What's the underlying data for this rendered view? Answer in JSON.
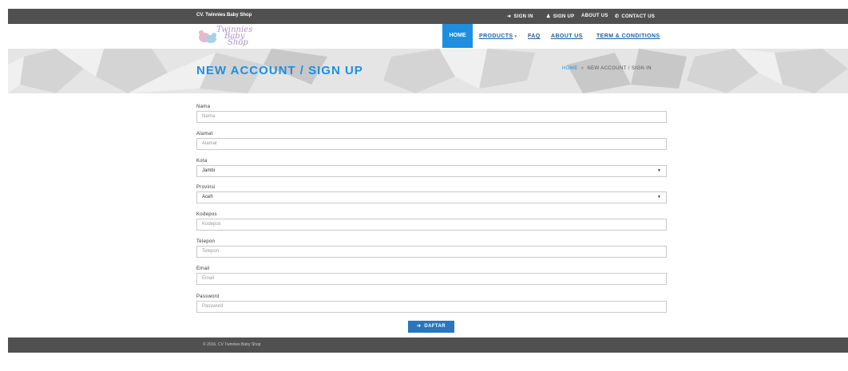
{
  "topbar": {
    "shop_name": "CV. Twinnies Baby Shop",
    "links": [
      {
        "label": "SIGN IN",
        "icon": "sign-in-icon"
      },
      {
        "label": "SIGN UP",
        "icon": "user-icon"
      },
      {
        "label": "ABOUT US",
        "icon": ""
      },
      {
        "label": "CONTACT US",
        "icon": "phone-icon"
      }
    ]
  },
  "logo": {
    "line1": "Twinnies",
    "line2": "Baby",
    "line3": "Shop"
  },
  "nav": {
    "home": "HOME",
    "products": "PRODUCTS",
    "faq": "FAQ",
    "about": "ABOUT US",
    "terms": "TERM & CONDITIONS"
  },
  "banner": {
    "title": "NEW ACCOUNT / SIGN UP",
    "breadcrumb_home": "HOME",
    "breadcrumb_separator": "»",
    "breadcrumb_current": "NEW ACCOUNT / SIGN IN"
  },
  "form": {
    "fields": [
      {
        "label": "Nama",
        "type": "text",
        "placeholder": "Nama"
      },
      {
        "label": "Alamat",
        "type": "text",
        "placeholder": "Alamat"
      },
      {
        "label": "Kota",
        "type": "select",
        "value": "Jambi"
      },
      {
        "label": "Provinsi",
        "type": "select",
        "value": "Aceh"
      },
      {
        "label": "Kodepos",
        "type": "text",
        "placeholder": "Kodepos"
      },
      {
        "label": "Telepon",
        "type": "text",
        "placeholder": "Telepon"
      },
      {
        "label": "Email",
        "type": "text",
        "placeholder": "Email"
      },
      {
        "label": "Password",
        "type": "password",
        "placeholder": "Password"
      }
    ],
    "submit_label": "DAFTAR"
  },
  "footer": {
    "copyright": "© 2016. CV Twinnies Baby Shop"
  },
  "colors": {
    "accent": "#1e8fe0",
    "button": "#2a75bb",
    "bar": "#505050",
    "link": "#1f5fa0"
  }
}
